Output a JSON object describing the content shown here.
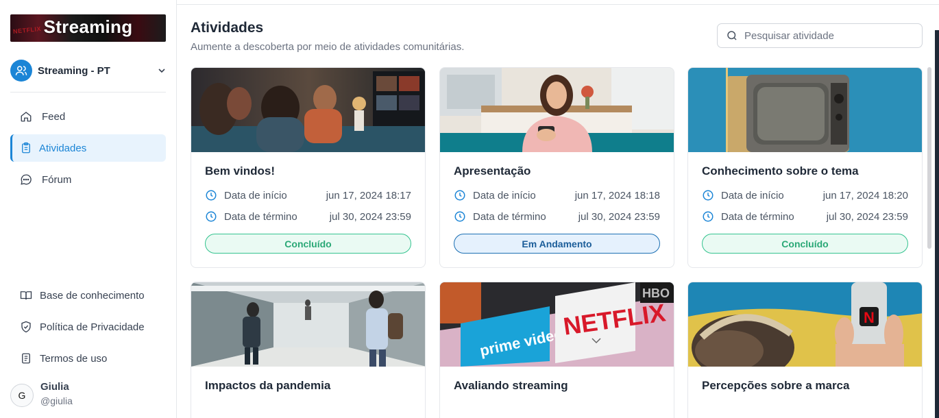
{
  "brand": {
    "logo_text": "Streaming",
    "logo_mini": "NETFLIX"
  },
  "community": {
    "name": "Streaming - PT"
  },
  "nav": [
    {
      "label": "Feed",
      "icon": "home-icon"
    },
    {
      "label": "Atividades",
      "icon": "clipboard-icon",
      "active": true
    },
    {
      "label": "Fórum",
      "icon": "chat-icon"
    }
  ],
  "bottom_nav": [
    {
      "label": "Base de conhecimento",
      "icon": "book-icon"
    },
    {
      "label": "Política de Privacidade",
      "icon": "shield-icon"
    },
    {
      "label": "Termos de uso",
      "icon": "document-icon"
    }
  ],
  "user": {
    "initial": "G",
    "name": "Giulia",
    "handle": "@giulia"
  },
  "page": {
    "title": "Atividades",
    "subtitle": "Aumente a descoberta por meio de atividades comunitárias.",
    "search_placeholder": "Pesquisar atividade"
  },
  "labels": {
    "start": "Data de início",
    "end": "Data de término"
  },
  "cards": [
    {
      "title": "Bem vindos!",
      "start": "jun 17, 2024 18:17",
      "end": "jul 30, 2024 23:59",
      "status": "Concluído",
      "status_kind": "done"
    },
    {
      "title": "Apresentação",
      "start": "jun 17, 2024 18:18",
      "end": "jul 30, 2024 23:59",
      "status": "Em Andamento",
      "status_kind": "progress"
    },
    {
      "title": "Conhecimento sobre o tema",
      "start": "jun 17, 2024 18:20",
      "end": "jul 30, 2024 23:59",
      "status": "Concluído",
      "status_kind": "done"
    },
    {
      "title": "Impactos da pandemia"
    },
    {
      "title": "Avaliando streaming",
      "image_text": [
        "NETFLIX",
        "prime video",
        "HBO"
      ]
    },
    {
      "title": "Percepções sobre a marca",
      "image_text": "N"
    }
  ],
  "colors": {
    "accent": "#1b85d6",
    "done": "#2aa876",
    "progress": "#1b5d99"
  }
}
